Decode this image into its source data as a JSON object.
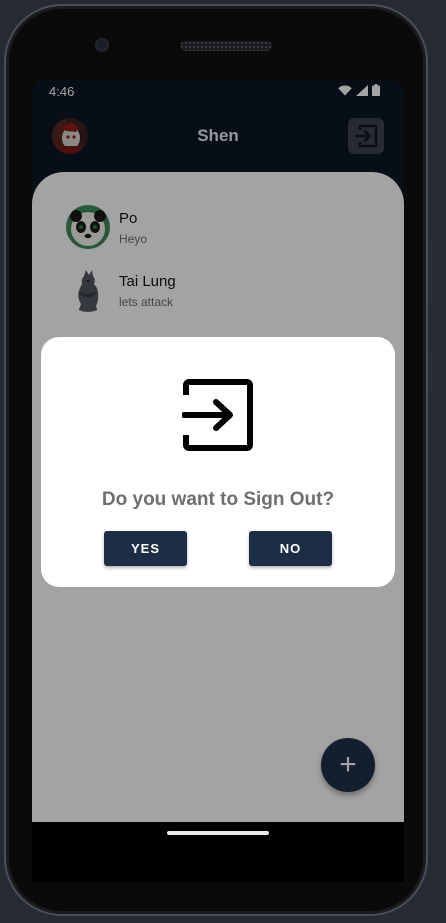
{
  "status": {
    "time": "4:46"
  },
  "appbar": {
    "title": "Shen"
  },
  "chats": [
    {
      "name": "Po",
      "message": "Heyo"
    },
    {
      "name": "Tai Lung",
      "message": "lets attack"
    }
  ],
  "dialog": {
    "question": "Do you want to Sign Out?",
    "yes_label": "YES",
    "no_label": "NO"
  },
  "fab": {
    "icon": "plus-icon",
    "label": "+"
  },
  "colors": {
    "primary": "#1d2d46",
    "appbar_bg": "#0e1724",
    "sheet_bg": "#ffffff"
  },
  "icons": {
    "logout": "logout-icon",
    "wifi": "wifi-icon",
    "signal": "signal-icon",
    "battery": "battery-icon"
  }
}
